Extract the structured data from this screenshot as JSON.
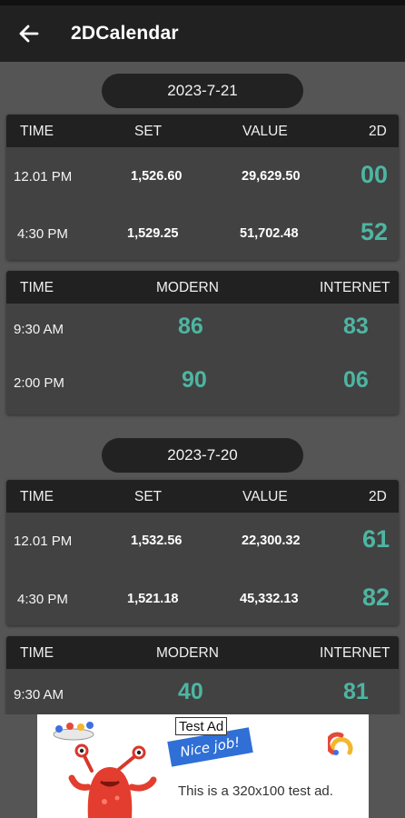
{
  "app": {
    "title": "2DCalendar"
  },
  "days": [
    {
      "date": "2023-7-21",
      "set_table": {
        "headers": {
          "time": "TIME",
          "set": "SET",
          "value": "VALUE",
          "twod": "2D"
        },
        "rows": [
          {
            "time": "12.01 PM",
            "set": "1,526.60",
            "value": "29,629.50",
            "twod": "00"
          },
          {
            "time": "4:30 PM",
            "set": "1,529.25",
            "value": "51,702.48",
            "twod": "52"
          }
        ]
      },
      "mi_table": {
        "headers": {
          "time": "TIME",
          "modern": "MODERN",
          "internet": "INTERNET"
        },
        "rows": [
          {
            "time": "9:30 AM",
            "modern": "86",
            "internet": "83"
          },
          {
            "time": "2:00 PM",
            "modern": "90",
            "internet": "06"
          }
        ]
      }
    },
    {
      "date": "2023-7-20",
      "set_table": {
        "headers": {
          "time": "TIME",
          "set": "SET",
          "value": "VALUE",
          "twod": "2D"
        },
        "rows": [
          {
            "time": "12.01 PM",
            "set": "1,532.56",
            "value": "22,300.32",
            "twod": "61"
          },
          {
            "time": "4:30 PM",
            "set": "1,521.18",
            "value": "45,332.13",
            "twod": "82"
          }
        ]
      },
      "mi_table": {
        "headers": {
          "time": "TIME",
          "modern": "MODERN",
          "internet": "INTERNET"
        },
        "rows": [
          {
            "time": "9:30 AM",
            "modern": "40",
            "internet": "81"
          }
        ]
      }
    }
  ],
  "ad": {
    "label": "Test Ad",
    "badge": "Nice job!",
    "text": "This is a 320x100 test ad."
  },
  "colors": {
    "accent": "#4db6a2",
    "appbar": "#212121",
    "background": "#555555"
  }
}
